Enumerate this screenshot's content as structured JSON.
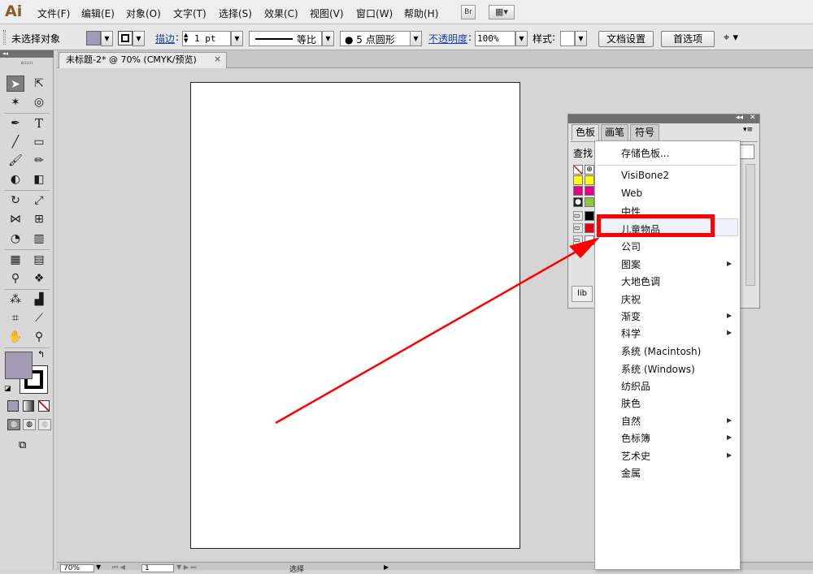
{
  "menubar": {
    "logo": "Ai",
    "items": [
      "文件(F)",
      "编辑(E)",
      "对象(O)",
      "文字(T)",
      "选择(S)",
      "效果(C)",
      "视图(V)",
      "窗口(W)",
      "帮助(H)"
    ],
    "bridge_label": "Br",
    "arrange_label": "▦▾"
  },
  "control_bar": {
    "selection": "未选择对象",
    "stroke_label": "描边",
    "stroke_weight": "1 pt",
    "stroke_profile": "等比",
    "brush": "●  5 点圆形",
    "opacity_label": "不透明度",
    "opacity_value": "100%",
    "style_label": "样式",
    "doc_setup": "文档设置",
    "preferences": "首选项",
    "fill_color": "#a39bb6"
  },
  "document": {
    "tab_title": "未标题-2* @ 70% (CMYK/预览)",
    "close": "×"
  },
  "status_bar": {
    "zoom": "70%",
    "page": "1",
    "mode": "选择"
  },
  "panel": {
    "tabs": [
      "色板",
      "画笔",
      "符号"
    ],
    "search_label": "查找",
    "bottom_icon": "lib",
    "collapse": "◂◂",
    "close": "✕"
  },
  "swatch_menu": {
    "items": [
      {
        "label": "存储色板...",
        "submenu": false
      },
      {
        "label": "VisiBone2",
        "submenu": false
      },
      {
        "label": "Web",
        "submenu": false
      },
      {
        "label": "中性",
        "submenu": false
      },
      {
        "label": "儿童物品",
        "submenu": false
      },
      {
        "label": "公司",
        "submenu": false
      },
      {
        "label": "图案",
        "submenu": true
      },
      {
        "label": "大地色调",
        "submenu": false
      },
      {
        "label": "庆祝",
        "submenu": false
      },
      {
        "label": "渐变",
        "submenu": true
      },
      {
        "label": "科学",
        "submenu": true
      },
      {
        "label": "系统 (Macintosh)",
        "submenu": false
      },
      {
        "label": "系统 (Windows)",
        "submenu": false
      },
      {
        "label": "纺织品",
        "submenu": false
      },
      {
        "label": "肤色",
        "submenu": false
      },
      {
        "label": "自然",
        "submenu": true
      },
      {
        "label": "色标簿",
        "submenu": true
      },
      {
        "label": "艺术史",
        "submenu": true
      },
      {
        "label": "金属",
        "submenu": false
      }
    ]
  },
  "colors": {
    "annotation": "#ff0000",
    "fill_swatch": "#a39bb6"
  }
}
